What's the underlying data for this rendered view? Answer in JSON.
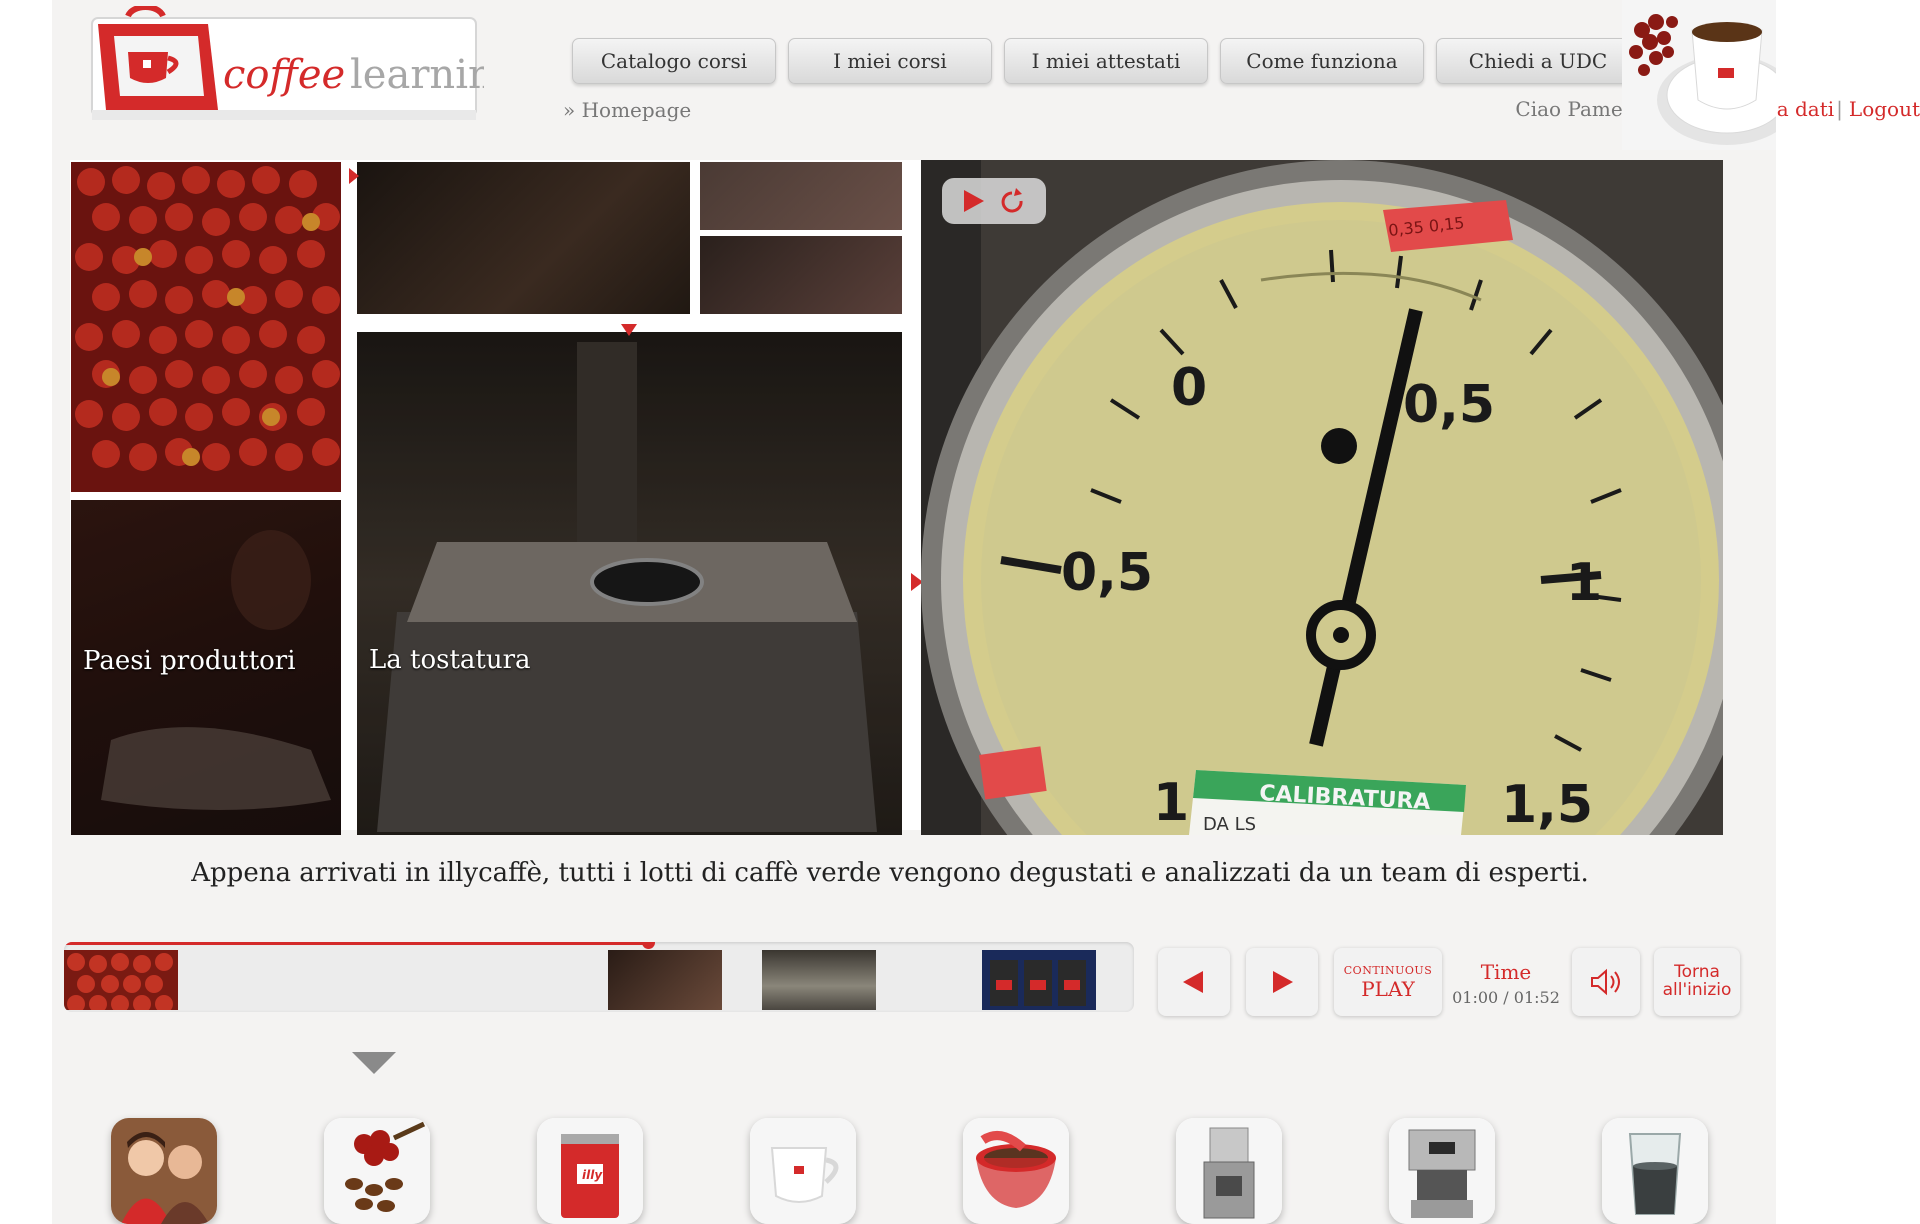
{
  "header": {
    "logo_text_1": "coffee",
    "logo_text_2": "learning",
    "nav": [
      {
        "label": "Catalogo corsi"
      },
      {
        "label": "I miei corsi"
      },
      {
        "label": "I miei attestati"
      },
      {
        "label": "Come funziona"
      },
      {
        "label": "Chiedi a UDC"
      }
    ],
    "breadcrumb": "» Homepage",
    "greeting": "Ciao Pamela Jelo",
    "edit_link": "Modifica dati",
    "logout_link": "Logout"
  },
  "tiles": {
    "paesi_label": "Paesi produttori",
    "tostatura_label": "La tostatura"
  },
  "gauge": {
    "scale_labels": [
      "0",
      "0,5",
      "0,5",
      "1",
      "1",
      "1,5"
    ],
    "sticker_top": "0,35  0,15",
    "calibration_label": "CALIBRATURA",
    "calibration_sub": "DA  LS"
  },
  "caption": "Appena arrivati in illycaffè, tutti i lotti di caffè verde vengono degustati e analizzati da un team di esperti.",
  "player": {
    "progress_fraction": 0.5455,
    "continuous_small": "CONTINUOUS",
    "continuous_big": "PLAY",
    "time_label": "Time",
    "time_value": "01:00 / 01:52",
    "restart_line1": "Torna",
    "restart_line2": "all'inizio"
  },
  "brand": {
    "accent": "#d42a2a",
    "tin_text": "illy"
  },
  "topics": [
    {
      "icon": "people-icon"
    },
    {
      "icon": "coffee-beans-icon"
    },
    {
      "icon": "coffee-tin-icon"
    },
    {
      "icon": "cup-icon"
    },
    {
      "icon": "cup-pour-icon"
    },
    {
      "icon": "grinder-icon"
    },
    {
      "icon": "espresso-machine-icon"
    },
    {
      "icon": "water-glass-icon"
    }
  ]
}
